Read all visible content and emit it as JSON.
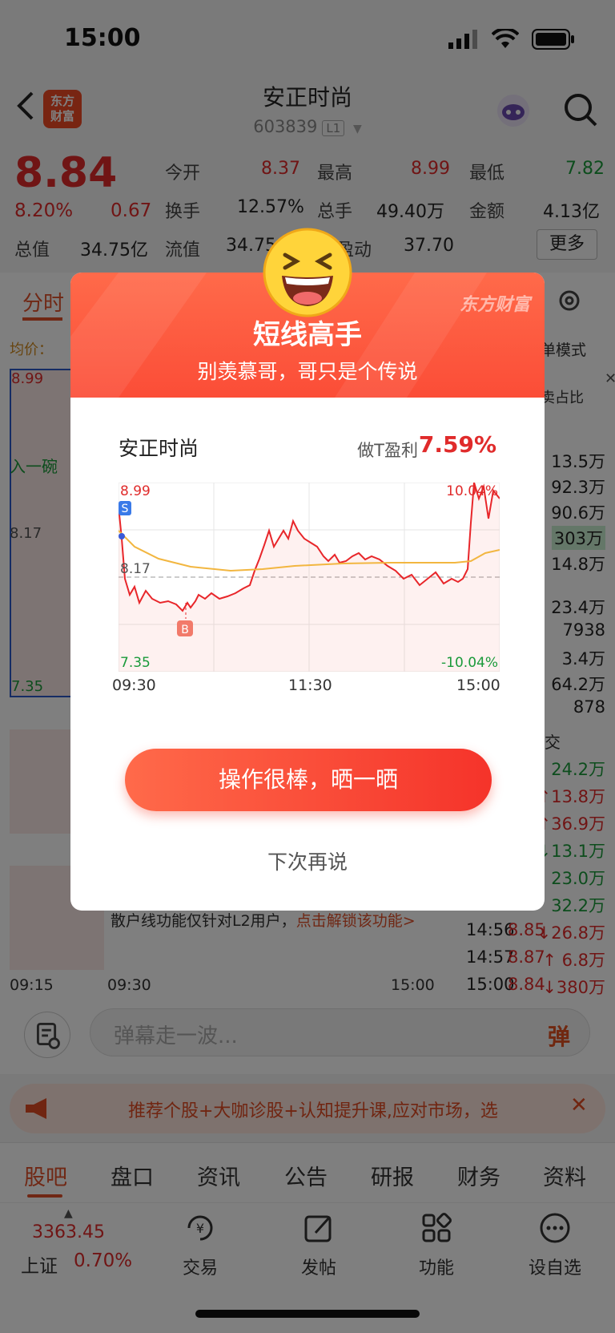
{
  "status_bar": {
    "time": "15:00"
  },
  "header": {
    "logo_text_1": "东方",
    "logo_text_2": "财富",
    "stock_name": "安正时尚",
    "stock_code": "603839",
    "level_badge": "L1"
  },
  "quote": {
    "price": "8.84",
    "change_pct": "8.20%",
    "change": "0.67",
    "rows": [
      [
        {
          "label": "今开",
          "value": "8.37",
          "color": "red"
        },
        {
          "label": "最高",
          "value": "8.99",
          "color": "red"
        },
        {
          "label": "最低",
          "value": "7.82",
          "color": "green"
        }
      ],
      [
        {
          "label": "换手",
          "value": "12.57%",
          "color": "dark"
        },
        {
          "label": "总手",
          "value": "49.40万",
          "color": "dark"
        },
        {
          "label": "金额",
          "value": "4.13亿",
          "color": "dark"
        }
      ]
    ],
    "total_mv_label": "总值",
    "total_mv": "34.75亿",
    "float_mv_label": "流值",
    "float_mv": "34.75",
    "pe_label": "盈动",
    "pe_value": "37.70",
    "more_label": "更多"
  },
  "bg": {
    "tab_label": "分时",
    "avg_label": "均价：",
    "chart_high": "8.99",
    "chart_low": "7.35",
    "chart_mid": "8.17",
    "side_text_1": "入一碗",
    "mode_label": "单模式",
    "ratio_label": "卖占比",
    "time_start": "09:15",
    "time_open": "09:30",
    "time_end": "15:00",
    "l2_notice": "散户线功能仅针对L2用户，",
    "l2_link": "点击解锁该功能>",
    "volume_list": [
      "13.5万",
      "92.3万",
      "90.6万",
      "303万",
      "14.8万",
      "23.4万",
      "7938",
      "3.4万",
      "64.2万",
      "878"
    ],
    "trades_header": "交",
    "trades": [
      {
        "time": "",
        "price": "",
        "vol": "24.2万"
      },
      {
        "time": "",
        "price": "",
        "vol": "↑13.8万"
      },
      {
        "time": "",
        "price": "",
        "vol": "↑36.9万"
      },
      {
        "time": "",
        "price": "",
        "vol": "↓13.1万"
      },
      {
        "time": "",
        "price": "",
        "vol": "23.0万"
      },
      {
        "time": "",
        "price": "",
        "vol": "32.2万"
      },
      {
        "time": "14:56",
        "price": "8.85",
        "vol": "↓26.8万"
      },
      {
        "time": "14:57",
        "price": "8.87",
        "vol": "↑ 6.8万"
      },
      {
        "time": "15:00",
        "price": "8.84",
        "vol": "↓380万"
      }
    ]
  },
  "input_bar": {
    "placeholder": "弹幕走一波...",
    "send_label": "弹"
  },
  "promo": {
    "text": "推荐个股+大咖诊股+认知提升课,应对市场，选",
    "close": "✕"
  },
  "nav_tabs": [
    "股吧",
    "盘口",
    "资讯",
    "公告",
    "研报",
    "财务",
    "资料"
  ],
  "toolbar": {
    "index_value": "3363.45",
    "index_name": "上证",
    "index_pct": "0.70%",
    "items": [
      {
        "label": "交易",
        "icon": "yen-cycle-icon"
      },
      {
        "label": "发帖",
        "icon": "edit-icon"
      },
      {
        "label": "功能",
        "icon": "grid-icon"
      },
      {
        "label": "设自选",
        "icon": "more-circle-icon"
      }
    ]
  },
  "modal": {
    "brand": "东方财富",
    "title": "短线高手",
    "subtitle": "别羡慕哥，哥只是个传说",
    "stock_name": "安正时尚",
    "profit_label": "做T盈利",
    "profit_value": "7.59%",
    "chart_high": "8.99",
    "chart_low": "7.35",
    "chart_mid": "8.17",
    "pct_high": "10.04%",
    "pct_low": "-10.04%",
    "time_labels": [
      "09:30",
      "11:30",
      "15:00"
    ],
    "sell_marker": "S",
    "buy_marker": "B",
    "share_button": "操作很棒，晒一晒",
    "later_button": "下次再说"
  }
}
